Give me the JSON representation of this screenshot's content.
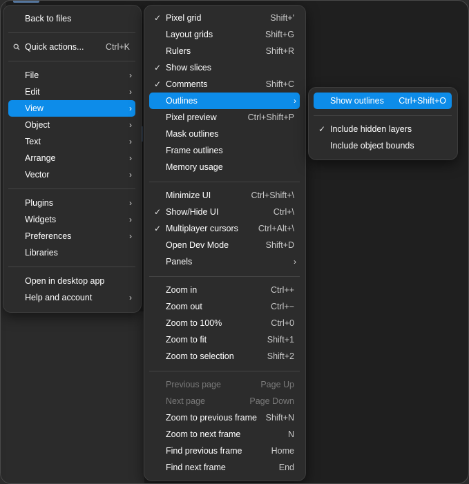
{
  "main_menu": {
    "back": "Back to files",
    "quick_actions": {
      "label": "Quick actions...",
      "shortcut": "Ctrl+K"
    },
    "group1": [
      {
        "label": "File",
        "submenu": true
      },
      {
        "label": "Edit",
        "submenu": true
      },
      {
        "label": "View",
        "submenu": true,
        "active": true
      },
      {
        "label": "Object",
        "submenu": true
      },
      {
        "label": "Text",
        "submenu": true
      },
      {
        "label": "Arrange",
        "submenu": true
      },
      {
        "label": "Vector",
        "submenu": true
      }
    ],
    "group2": [
      {
        "label": "Plugins",
        "submenu": true
      },
      {
        "label": "Widgets",
        "submenu": true
      },
      {
        "label": "Preferences",
        "submenu": true
      },
      {
        "label": "Libraries",
        "submenu": false
      }
    ],
    "group3": [
      {
        "label": "Open in desktop app",
        "submenu": false
      },
      {
        "label": "Help and account",
        "submenu": true
      }
    ]
  },
  "view_menu": {
    "group1": [
      {
        "label": "Pixel grid",
        "shortcut": "Shift+'",
        "checked": true
      },
      {
        "label": "Layout grids",
        "shortcut": "Shift+G",
        "checked": false
      },
      {
        "label": "Rulers",
        "shortcut": "Shift+R",
        "checked": false
      },
      {
        "label": "Show slices",
        "shortcut": "",
        "checked": true
      },
      {
        "label": "Comments",
        "shortcut": "Shift+C",
        "checked": true
      },
      {
        "label": "Outlines",
        "shortcut": "",
        "checked": false,
        "submenu": true,
        "active": true
      },
      {
        "label": "Pixel preview",
        "shortcut": "Ctrl+Shift+P",
        "checked": false
      },
      {
        "label": "Mask outlines",
        "shortcut": "",
        "checked": false
      },
      {
        "label": "Frame outlines",
        "shortcut": "",
        "checked": false
      },
      {
        "label": "Memory usage",
        "shortcut": "",
        "checked": false
      }
    ],
    "group2": [
      {
        "label": "Minimize UI",
        "shortcut": "Ctrl+Shift+\\",
        "checked": false
      },
      {
        "label": "Show/Hide UI",
        "shortcut": "Ctrl+\\",
        "checked": true
      },
      {
        "label": "Multiplayer cursors",
        "shortcut": "Ctrl+Alt+\\",
        "checked": true
      },
      {
        "label": "Open Dev Mode",
        "shortcut": "Shift+D",
        "checked": false
      },
      {
        "label": "Panels",
        "shortcut": "",
        "checked": false,
        "submenu": true
      }
    ],
    "group3": [
      {
        "label": "Zoom in",
        "shortcut": "Ctrl++"
      },
      {
        "label": "Zoom out",
        "shortcut": "Ctrl+−"
      },
      {
        "label": "Zoom to 100%",
        "shortcut": "Ctrl+0"
      },
      {
        "label": "Zoom to fit",
        "shortcut": "Shift+1"
      },
      {
        "label": "Zoom to selection",
        "shortcut": "Shift+2"
      }
    ],
    "group4": [
      {
        "label": "Previous page",
        "shortcut": "Page Up",
        "disabled": true
      },
      {
        "label": "Next page",
        "shortcut": "Page Down",
        "disabled": true
      },
      {
        "label": "Zoom to previous frame",
        "shortcut": "Shift+N",
        "disabled": false
      },
      {
        "label": "Zoom to next frame",
        "shortcut": "N",
        "disabled": false
      },
      {
        "label": "Find previous frame",
        "shortcut": "Home",
        "disabled": false
      },
      {
        "label": "Find next frame",
        "shortcut": "End",
        "disabled": false
      }
    ]
  },
  "outlines_menu": {
    "show": {
      "label": "Show outlines",
      "shortcut": "Ctrl+Shift+O",
      "active": true
    },
    "options": [
      {
        "label": "Include hidden layers",
        "checked": true
      },
      {
        "label": "Include object bounds",
        "checked": false
      }
    ]
  },
  "glyphs": {
    "check": "✓",
    "chevron": "›"
  },
  "colors": {
    "accent": "#0d8ce9",
    "menu_bg": "#2c2c2c",
    "canvas_bg": "#1f1f1f"
  }
}
